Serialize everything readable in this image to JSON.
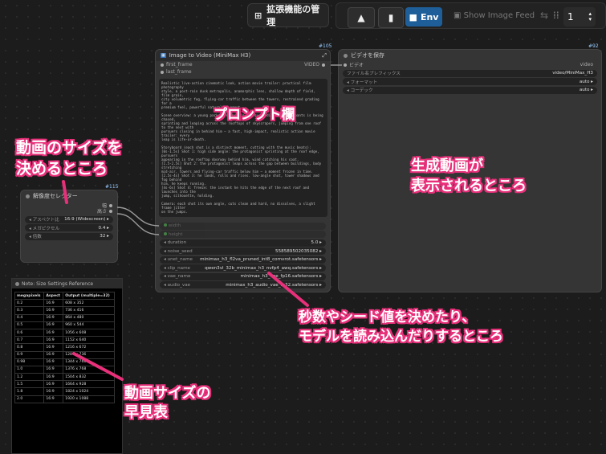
{
  "topbar": {
    "extensions_label": "拡張機能の管理",
    "env_label": "Env",
    "feed_label": "Show Image Feed",
    "quantity": "1"
  },
  "node_105": {
    "id": "#105",
    "title": "Image to Video (MiniMax H3)",
    "inputs": [
      "first_frame",
      "last_frame"
    ],
    "output": "VIDEO",
    "prompt": "Realistic live-action cinematic look, action movie trailer: practical film photography\nstyle, a post-rain dusk metropolis, anamorphic lens, shallow depth of field, film grain,\ncity volumetric fog, flying-car traffic between the towers, restrained grading for a\npremium feel, powerful natural movement.\n\nScene overview: a young parkour runner in a grey hoodie and cargo pants is being chased,\nsprinting and leaping across the rooftops of skyscrapers, jumping from one roof to the next with\npursuers closing in behind him — a fast, high-impact, realistic action movie trailer: every\nleap is life-or-death.\n\nStoryboard (each shot is a distinct moment, cutting with the music beats):\n[0s-1.5s] Shot 1: high side angle: the protagonist sprinting at the roof edge, pursuers\nappearing in the rooftop doorway behind him, wind catching his coat.\n[1.5-2.5s] Shot 2: the protagonist leaps across the gap between buildings, body stretching\nmid-air, towers and flying-car traffic below him — a moment frozen in time.\n[2.5s-4s] Shot 3: he lands, rolls and rises. low-angle shot, tower shadows and fog behind\nhim, he keeps running.\n[4s-6s] Shot 4: freeze: the instant he hits the edge of the next roof and launches into the\njump, silhouette, holding.\n\nCamera: each shot its own angle, cuts clean and hard, no dissolves, a slight frame jitter\non the jumps.\n\nAudio: wind, rapid footsteps, city ambience, low score underneath, an accent hit on each\nleap, the score bursting at 4s, closing the last ½.\n\nNo text, subtitles, logos or watermarks of any kind, no animation or cartoon rendering, no\noverly-CG look, keep the live-action texture.",
    "dim_inputs": [
      "width",
      "height"
    ],
    "widgets": [
      {
        "label": "duration",
        "value": "5.0"
      },
      {
        "label": "noise_seed",
        "value": "558589502035082"
      },
      {
        "label": "unet_name",
        "value": "minimax_h3_fl2va_pruned_int8_comvrot.safetensors"
      },
      {
        "label": "clip_name",
        "value": "qwen3vl_32b_minimax_h3_nvfp4_awq.safetensors"
      },
      {
        "label": "vae_name",
        "value": "minimax_h3_vae_fp16.safetensors"
      },
      {
        "label": "audio_vae",
        "value": "minimax_h3_audio_vae_fp32.safetensors"
      }
    ]
  },
  "node_92": {
    "id": "#92",
    "title": "ビデオを保存",
    "input": "ビデオ",
    "input_type": "video",
    "widgets": [
      {
        "label": "ファイル名プレフィックス",
        "value": "video/MiniMax_H3"
      },
      {
        "label": "フォーマット",
        "value": "auto"
      },
      {
        "label": "コーデック",
        "value": "auto"
      }
    ]
  },
  "node_115": {
    "id": "#115",
    "title": "解像度セレクター",
    "outputs": [
      "幅",
      "高さ"
    ],
    "widgets": [
      {
        "label": "アスペクト比",
        "value": "16:9 (Widescreen)"
      },
      {
        "label": "メガピクセル",
        "value": "0.4"
      },
      {
        "label": "倍数",
        "value": "32"
      }
    ]
  },
  "note": {
    "title": "Note: Size Settings Reference",
    "headers": [
      "megapixels",
      "Aspect",
      "Output (multiple=32)"
    ],
    "rows": [
      [
        "0.2",
        "16:9",
        "608 x 352"
      ],
      [
        "0.3",
        "16:9",
        "736 x 416"
      ],
      [
        "0.4",
        "16:9",
        "864 x 480"
      ],
      [
        "0.5",
        "16:9",
        "960 x 544"
      ],
      [
        "0.6",
        "16:9",
        "1056 x 608"
      ],
      [
        "0.7",
        "16:9",
        "1152 x 640"
      ],
      [
        "0.8",
        "16:9",
        "1216 x 672"
      ],
      [
        "0.9",
        "16:9",
        "1280 x 736"
      ],
      [
        "0.98",
        "16:9",
        "1344 x 768"
      ],
      [
        "1.0",
        "16:9",
        "1376 x 768"
      ],
      [
        "1.2",
        "16:9",
        "1504 x 832"
      ],
      [
        "1.5",
        "16:9",
        "1664 x 928"
      ],
      [
        "1.8",
        "16:9",
        "1824 x 1024"
      ],
      [
        "2.0",
        "16:9",
        "1920 x 1088"
      ]
    ]
  },
  "annotations": {
    "size_note_1": "動画のサイズを",
    "size_note_2": "決めるところ",
    "prompt_note": "プロンプト欄",
    "output_note_1": "生成動画が",
    "output_note_2": "表示されるところ",
    "settings_note_1": "秒数やシード値を決めたり、",
    "settings_note_2": "モデルを読み込んだりするところ",
    "table_note_1": "動画サイズの",
    "table_note_2": "早見表"
  },
  "colors": {
    "annotation_stroke": "#e8307a",
    "env_button": "#1f5f99",
    "node_bg": "#353535"
  }
}
